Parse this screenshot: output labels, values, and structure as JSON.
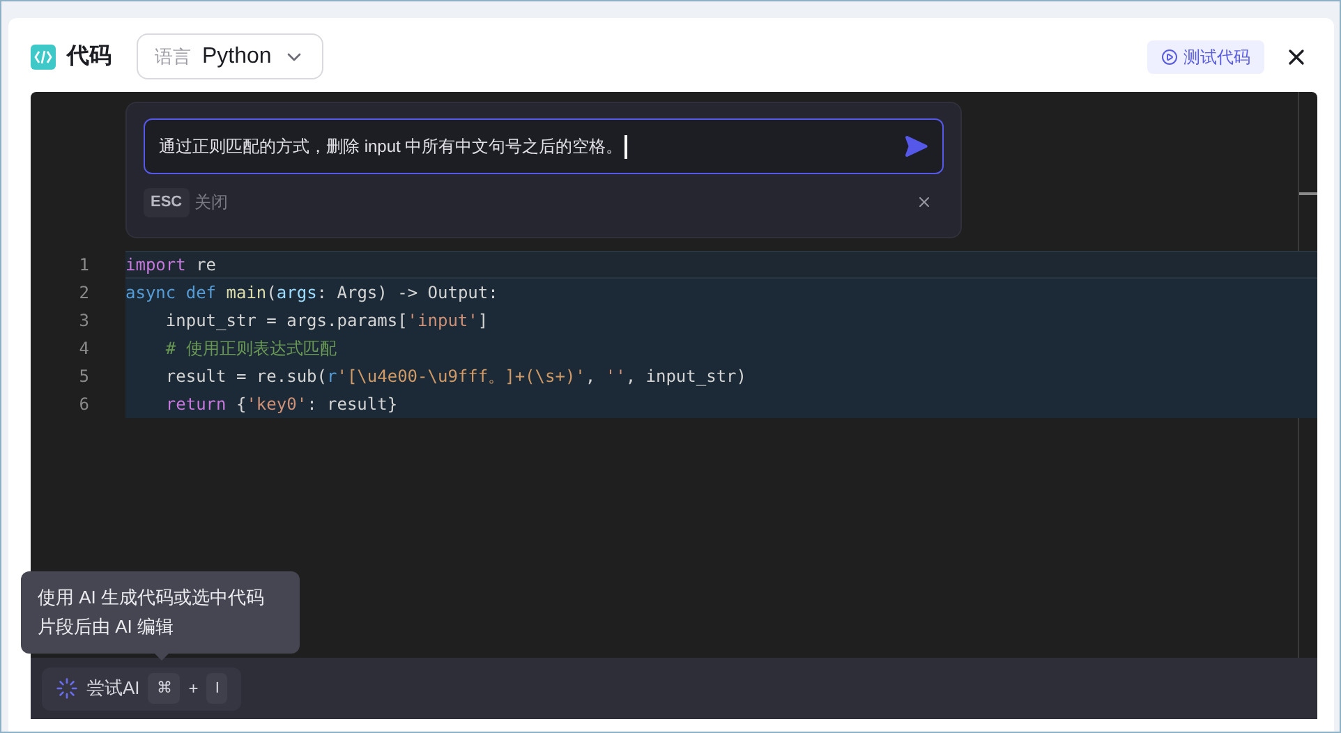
{
  "header": {
    "title": "代码",
    "language_label": "语言",
    "language": "Python",
    "test_button": "测试代码"
  },
  "ai_prompt": {
    "value": "通过正则匹配的方式，删除 input 中所有中文句号之后的空格。",
    "esc_key": "ESC",
    "esc_label": "关闭"
  },
  "code_lines": [
    {
      "number": "1",
      "current": true,
      "tokens": [
        {
          "text": "import",
          "kind": "control"
        },
        {
          "text": " re",
          "kind": "plain"
        }
      ]
    },
    {
      "number": "2",
      "current": false,
      "tokens": [
        {
          "text": "async def",
          "kind": "keyword"
        },
        {
          "text": " main",
          "kind": "function"
        },
        {
          "text": "(",
          "kind": "plain"
        },
        {
          "text": "args",
          "kind": "param"
        },
        {
          "text": ": Args) -> Output:",
          "kind": "plain"
        }
      ]
    },
    {
      "number": "3",
      "current": false,
      "tokens": [
        {
          "text": "    input_str = args.params[",
          "kind": "plain"
        },
        {
          "text": "'input'",
          "kind": "string"
        },
        {
          "text": "]",
          "kind": "plain"
        }
      ]
    },
    {
      "number": "4",
      "current": false,
      "tokens": [
        {
          "text": "    # 使用正则表达式匹配",
          "kind": "comment"
        }
      ]
    },
    {
      "number": "5",
      "current": false,
      "tokens": [
        {
          "text": "    result = re.sub(",
          "kind": "plain"
        },
        {
          "text": "r",
          "kind": "keyword"
        },
        {
          "text": "'[\\u4e00-\\u9fff。]+(\\s+)'",
          "kind": "regex"
        },
        {
          "text": ", ",
          "kind": "plain"
        },
        {
          "text": "''",
          "kind": "string"
        },
        {
          "text": ", input_str)",
          "kind": "plain"
        }
      ]
    },
    {
      "number": "6",
      "current": false,
      "tokens": [
        {
          "text": "    return",
          "kind": "control"
        },
        {
          "text": " {",
          "kind": "plain"
        },
        {
          "text": "'key0'",
          "kind": "string"
        },
        {
          "text": ": result}",
          "kind": "plain"
        }
      ]
    }
  ],
  "tooltip": "使用 AI 生成代码或选中代码片段后由 AI 编辑",
  "ai_bar": {
    "label": "尝试AI",
    "keys": [
      "⌘",
      "I"
    ],
    "plus": "+"
  }
}
